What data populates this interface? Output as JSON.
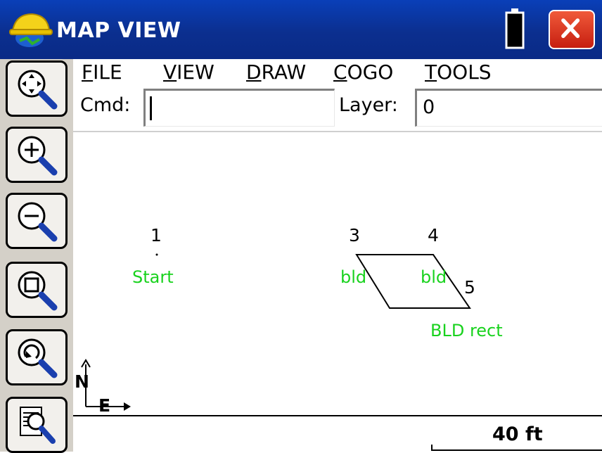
{
  "window": {
    "title": "MAP VIEW",
    "close_label": "X"
  },
  "toolbar": {
    "tools": [
      {
        "name": "zoom-extents-icon"
      },
      {
        "name": "zoom-in-icon"
      },
      {
        "name": "zoom-out-icon"
      },
      {
        "name": "zoom-window-icon"
      },
      {
        "name": "zoom-previous-icon"
      },
      {
        "name": "zoom-properties-icon"
      }
    ]
  },
  "menu": {
    "file": {
      "first": "F",
      "rest": "ILE"
    },
    "view": {
      "first": "V",
      "rest": "IEW"
    },
    "draw": {
      "first": "D",
      "rest": "RAW"
    },
    "cogo": {
      "first": "C",
      "rest": "OGO"
    },
    "tools": {
      "first": "T",
      "rest": "OOLS"
    }
  },
  "command": {
    "label": "Cmd:",
    "value": ""
  },
  "layer": {
    "label": "Layer:",
    "value": "0"
  },
  "map": {
    "points": [
      {
        "id": "1",
        "desc": "Start"
      },
      {
        "id": "3",
        "desc": "bld"
      },
      {
        "id": "4",
        "desc": "bld"
      },
      {
        "id": "5",
        "desc": "BLD rect"
      }
    ],
    "north_label": "N",
    "east_label": "E",
    "description_color": "#19d21e"
  },
  "scale": {
    "label": "40 ft"
  },
  "colors": {
    "titlebar": "#0b2f8f",
    "close_button": "#d9271a"
  }
}
